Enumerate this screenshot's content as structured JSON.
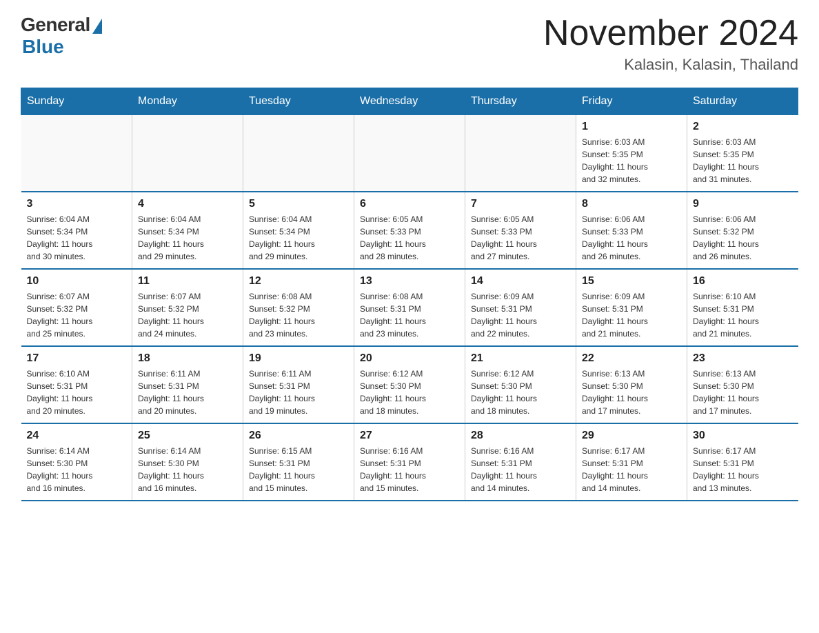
{
  "header": {
    "logo_general": "General",
    "logo_blue": "Blue",
    "month_year": "November 2024",
    "location": "Kalasin, Kalasin, Thailand"
  },
  "weekdays": [
    "Sunday",
    "Monday",
    "Tuesday",
    "Wednesday",
    "Thursday",
    "Friday",
    "Saturday"
  ],
  "weeks": [
    [
      {
        "day": "",
        "info": ""
      },
      {
        "day": "",
        "info": ""
      },
      {
        "day": "",
        "info": ""
      },
      {
        "day": "",
        "info": ""
      },
      {
        "day": "",
        "info": ""
      },
      {
        "day": "1",
        "info": "Sunrise: 6:03 AM\nSunset: 5:35 PM\nDaylight: 11 hours\nand 32 minutes."
      },
      {
        "day": "2",
        "info": "Sunrise: 6:03 AM\nSunset: 5:35 PM\nDaylight: 11 hours\nand 31 minutes."
      }
    ],
    [
      {
        "day": "3",
        "info": "Sunrise: 6:04 AM\nSunset: 5:34 PM\nDaylight: 11 hours\nand 30 minutes."
      },
      {
        "day": "4",
        "info": "Sunrise: 6:04 AM\nSunset: 5:34 PM\nDaylight: 11 hours\nand 29 minutes."
      },
      {
        "day": "5",
        "info": "Sunrise: 6:04 AM\nSunset: 5:34 PM\nDaylight: 11 hours\nand 29 minutes."
      },
      {
        "day": "6",
        "info": "Sunrise: 6:05 AM\nSunset: 5:33 PM\nDaylight: 11 hours\nand 28 minutes."
      },
      {
        "day": "7",
        "info": "Sunrise: 6:05 AM\nSunset: 5:33 PM\nDaylight: 11 hours\nand 27 minutes."
      },
      {
        "day": "8",
        "info": "Sunrise: 6:06 AM\nSunset: 5:33 PM\nDaylight: 11 hours\nand 26 minutes."
      },
      {
        "day": "9",
        "info": "Sunrise: 6:06 AM\nSunset: 5:32 PM\nDaylight: 11 hours\nand 26 minutes."
      }
    ],
    [
      {
        "day": "10",
        "info": "Sunrise: 6:07 AM\nSunset: 5:32 PM\nDaylight: 11 hours\nand 25 minutes."
      },
      {
        "day": "11",
        "info": "Sunrise: 6:07 AM\nSunset: 5:32 PM\nDaylight: 11 hours\nand 24 minutes."
      },
      {
        "day": "12",
        "info": "Sunrise: 6:08 AM\nSunset: 5:32 PM\nDaylight: 11 hours\nand 23 minutes."
      },
      {
        "day": "13",
        "info": "Sunrise: 6:08 AM\nSunset: 5:31 PM\nDaylight: 11 hours\nand 23 minutes."
      },
      {
        "day": "14",
        "info": "Sunrise: 6:09 AM\nSunset: 5:31 PM\nDaylight: 11 hours\nand 22 minutes."
      },
      {
        "day": "15",
        "info": "Sunrise: 6:09 AM\nSunset: 5:31 PM\nDaylight: 11 hours\nand 21 minutes."
      },
      {
        "day": "16",
        "info": "Sunrise: 6:10 AM\nSunset: 5:31 PM\nDaylight: 11 hours\nand 21 minutes."
      }
    ],
    [
      {
        "day": "17",
        "info": "Sunrise: 6:10 AM\nSunset: 5:31 PM\nDaylight: 11 hours\nand 20 minutes."
      },
      {
        "day": "18",
        "info": "Sunrise: 6:11 AM\nSunset: 5:31 PM\nDaylight: 11 hours\nand 20 minutes."
      },
      {
        "day": "19",
        "info": "Sunrise: 6:11 AM\nSunset: 5:31 PM\nDaylight: 11 hours\nand 19 minutes."
      },
      {
        "day": "20",
        "info": "Sunrise: 6:12 AM\nSunset: 5:30 PM\nDaylight: 11 hours\nand 18 minutes."
      },
      {
        "day": "21",
        "info": "Sunrise: 6:12 AM\nSunset: 5:30 PM\nDaylight: 11 hours\nand 18 minutes."
      },
      {
        "day": "22",
        "info": "Sunrise: 6:13 AM\nSunset: 5:30 PM\nDaylight: 11 hours\nand 17 minutes."
      },
      {
        "day": "23",
        "info": "Sunrise: 6:13 AM\nSunset: 5:30 PM\nDaylight: 11 hours\nand 17 minutes."
      }
    ],
    [
      {
        "day": "24",
        "info": "Sunrise: 6:14 AM\nSunset: 5:30 PM\nDaylight: 11 hours\nand 16 minutes."
      },
      {
        "day": "25",
        "info": "Sunrise: 6:14 AM\nSunset: 5:30 PM\nDaylight: 11 hours\nand 16 minutes."
      },
      {
        "day": "26",
        "info": "Sunrise: 6:15 AM\nSunset: 5:31 PM\nDaylight: 11 hours\nand 15 minutes."
      },
      {
        "day": "27",
        "info": "Sunrise: 6:16 AM\nSunset: 5:31 PM\nDaylight: 11 hours\nand 15 minutes."
      },
      {
        "day": "28",
        "info": "Sunrise: 6:16 AM\nSunset: 5:31 PM\nDaylight: 11 hours\nand 14 minutes."
      },
      {
        "day": "29",
        "info": "Sunrise: 6:17 AM\nSunset: 5:31 PM\nDaylight: 11 hours\nand 14 minutes."
      },
      {
        "day": "30",
        "info": "Sunrise: 6:17 AM\nSunset: 5:31 PM\nDaylight: 11 hours\nand 13 minutes."
      }
    ]
  ]
}
